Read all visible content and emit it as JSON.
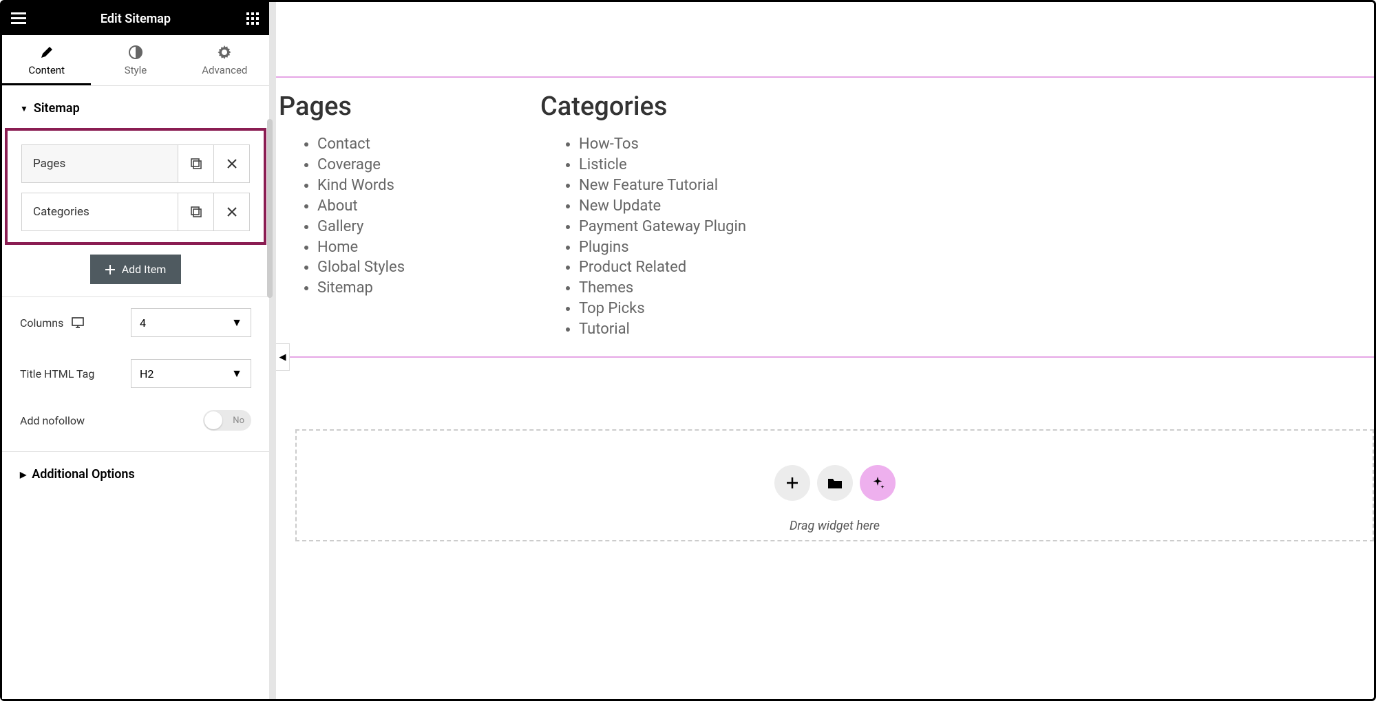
{
  "header": {
    "title": "Edit Sitemap"
  },
  "tabs": [
    {
      "label": "Content",
      "active": true
    },
    {
      "label": "Style",
      "active": false
    },
    {
      "label": "Advanced",
      "active": false
    }
  ],
  "section": {
    "title": "Sitemap"
  },
  "items": [
    {
      "label": "Pages"
    },
    {
      "label": "Categories"
    }
  ],
  "add_item_label": "Add Item",
  "controls": {
    "columns_label": "Columns",
    "columns_value": "4",
    "title_tag_label": "Title HTML Tag",
    "title_tag_value": "H2",
    "nofollow_label": "Add nofollow",
    "nofollow_value": "No"
  },
  "additional_section": {
    "title": "Additional Options"
  },
  "preview": {
    "columns": [
      {
        "title": "Pages",
        "items": [
          "Contact",
          "Coverage",
          "Kind Words",
          "About",
          "Gallery",
          "Home",
          "Global Styles",
          "Sitemap"
        ]
      },
      {
        "title": "Categories",
        "items": [
          "How-Tos",
          "Listicle",
          "New Feature Tutorial",
          "New Update",
          "Payment Gateway Plugin",
          "Plugins",
          "Product Related",
          "Themes",
          "Top Picks",
          "Tutorial"
        ]
      }
    ]
  },
  "dropzone_label": "Drag widget here"
}
